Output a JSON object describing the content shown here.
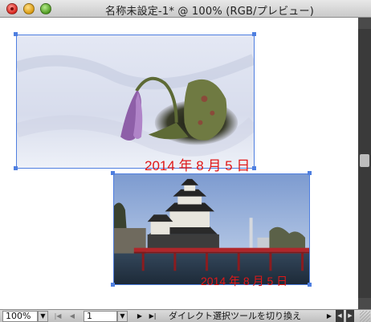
{
  "window": {
    "title": "名称未設定-1* @ 100% (RGB/プレビュー)"
  },
  "images": [
    {
      "name": "snow-flower-photo",
      "date_stamp": "2014 年 8 月 5 日",
      "subject": "dogtooth violet in snow"
    },
    {
      "name": "castle-photo",
      "date_stamp": "2014 年 8 月 5 日",
      "subject": "castle with red bridge"
    }
  ],
  "colors": {
    "selection": "#4f7fe0",
    "date_stamp": "#e01818",
    "scrollbar": "#3a3a3a"
  },
  "statusbar": {
    "zoom": "100%",
    "page": "1",
    "tool_hint": "ダイレクト選択ツールを切り換え"
  }
}
